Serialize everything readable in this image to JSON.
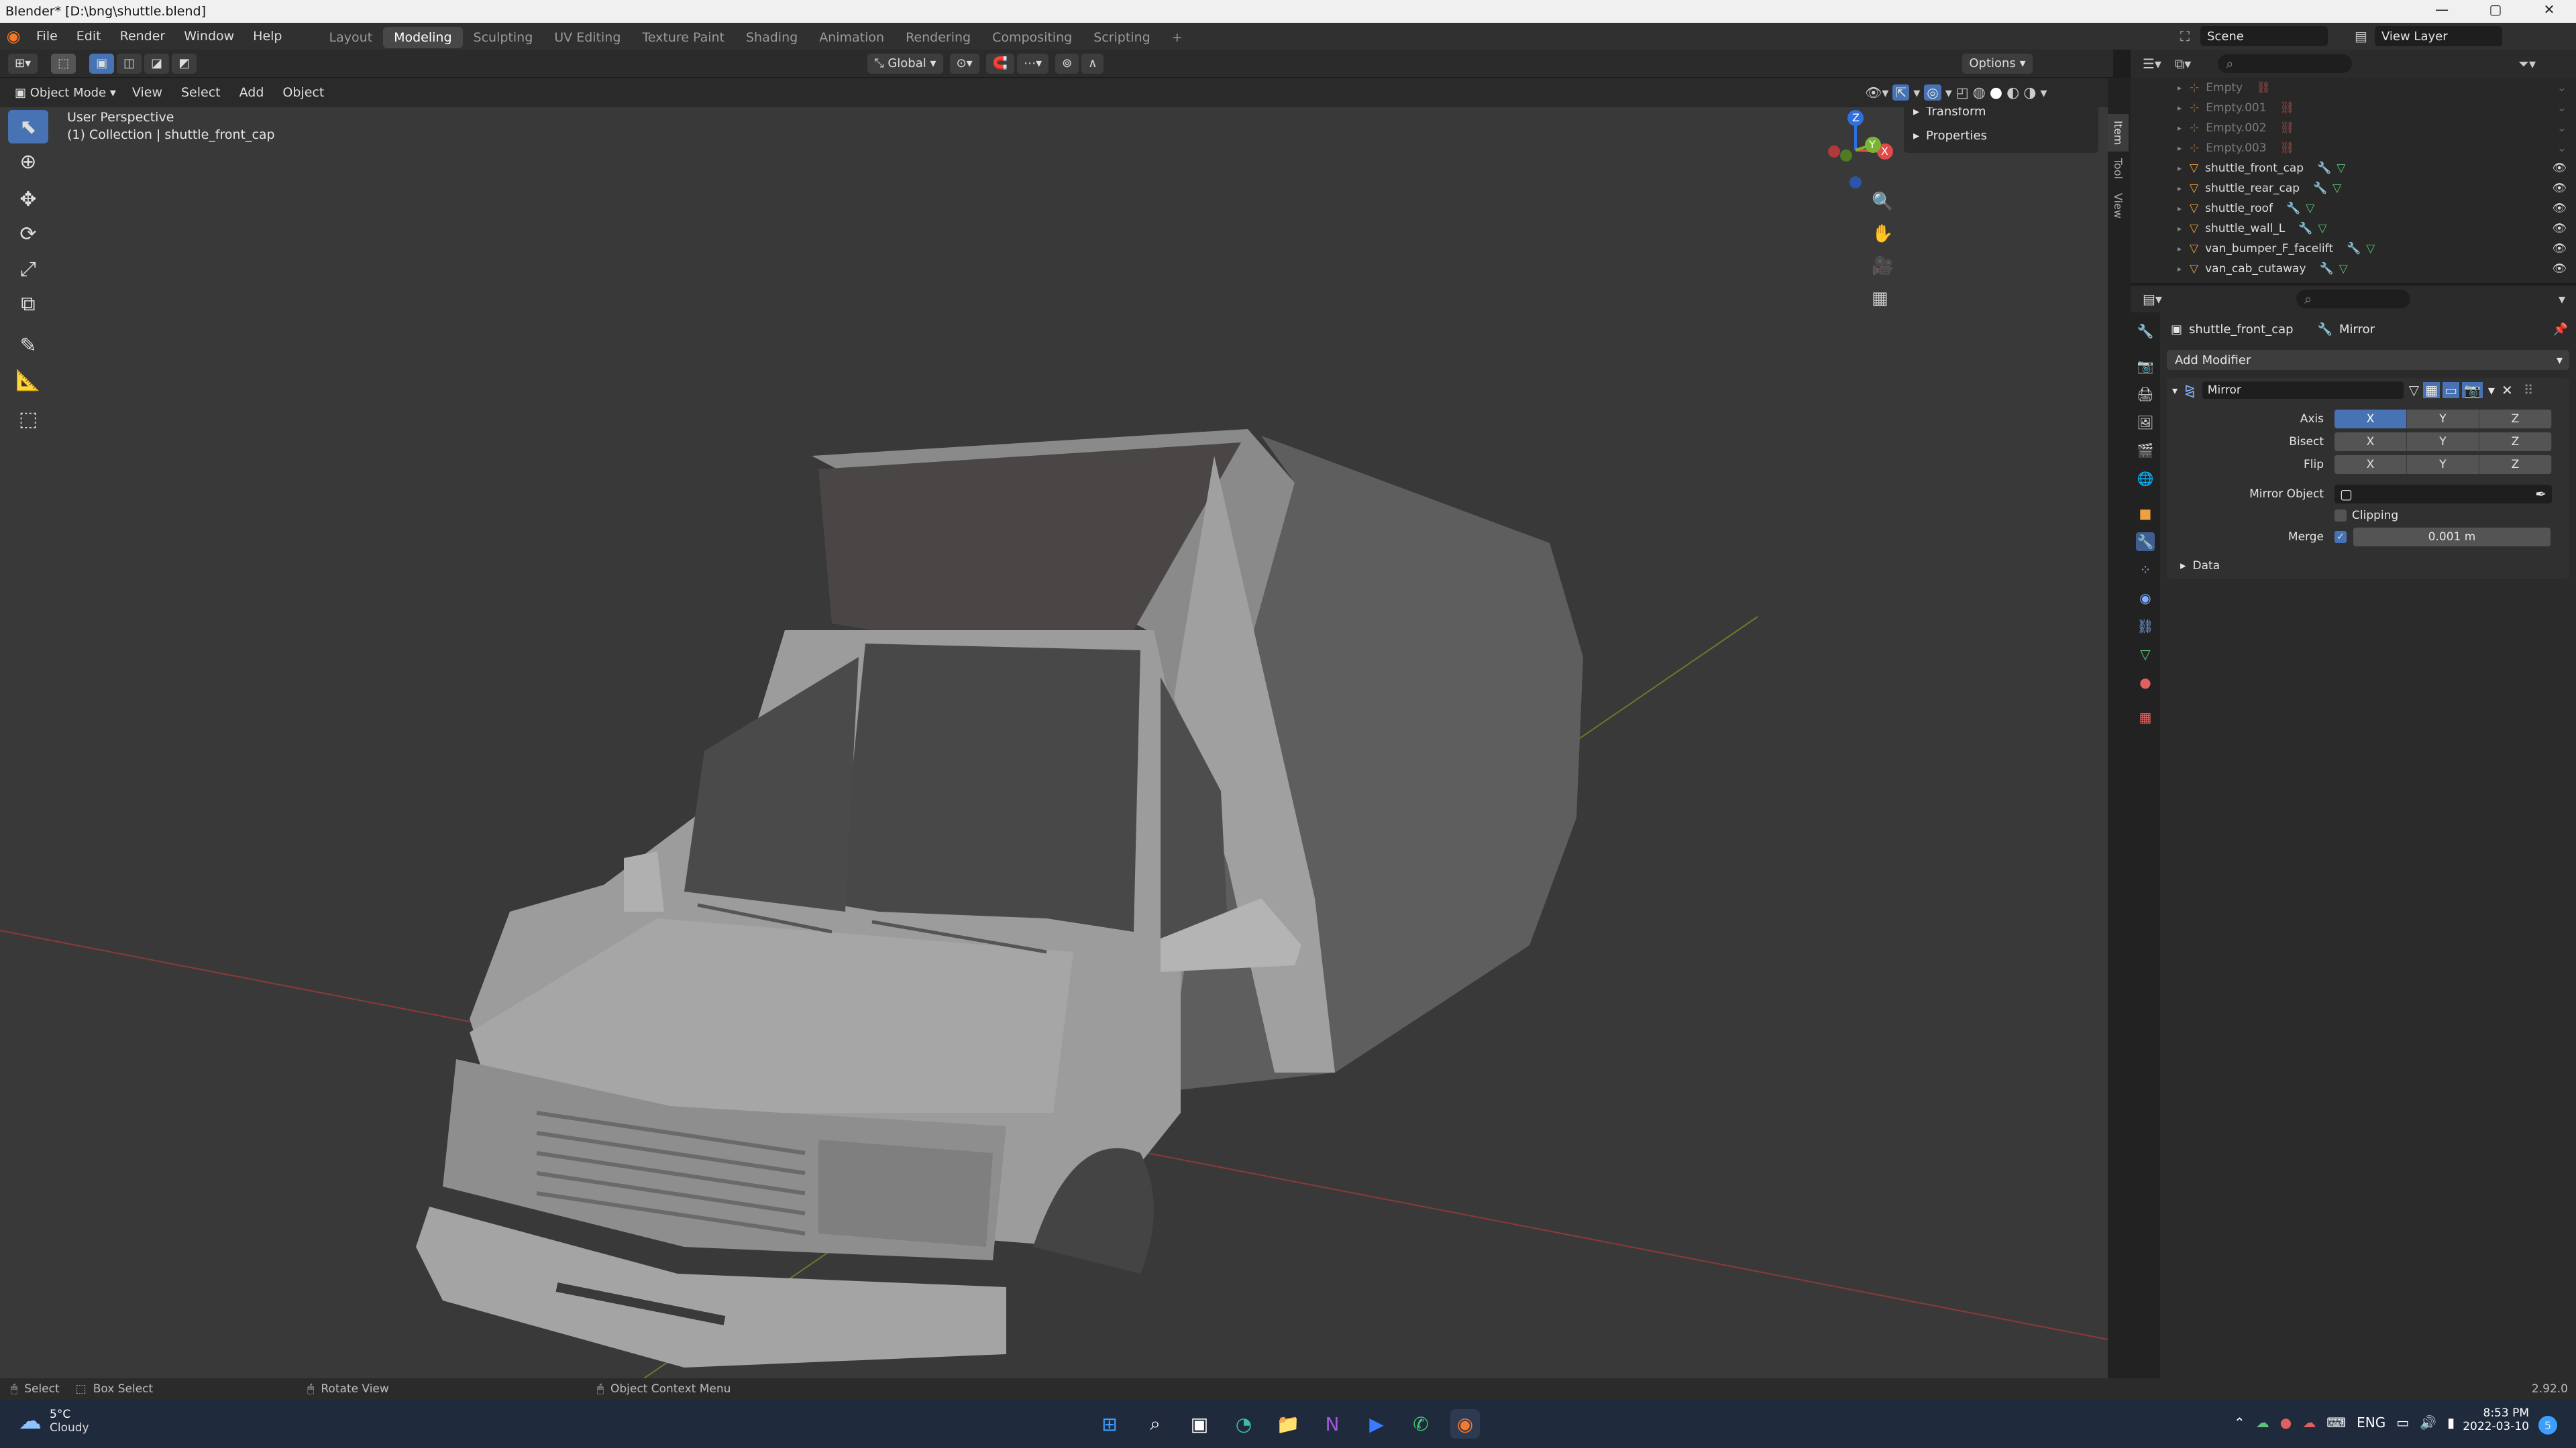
{
  "window": {
    "title": "Blender* [D:\\bng\\shuttle.blend]",
    "minimize": "—",
    "maximize": "▢",
    "close": "✕"
  },
  "menu": [
    "File",
    "Edit",
    "Render",
    "Window",
    "Help"
  ],
  "workspaces": [
    "Layout",
    "Modeling",
    "Sculpting",
    "UV Editing",
    "Texture Paint",
    "Shading",
    "Animation",
    "Rendering",
    "Compositing",
    "Scripting"
  ],
  "active_workspace": "Modeling",
  "scene": {
    "label": "Scene",
    "view_layer": "View Layer"
  },
  "toolrow": {
    "orientation": "Global",
    "options": "Options"
  },
  "viewport_header": {
    "mode": "Object Mode",
    "menus": [
      "View",
      "Select",
      "Add",
      "Object"
    ]
  },
  "viewport": {
    "perspective": "User Perspective",
    "collection": "(1) Collection | shuttle_front_cap",
    "gizmo_x": "X",
    "gizmo_y": "Y",
    "gizmo_z": "Z"
  },
  "npanel": {
    "transform": "Transform",
    "properties": "Properties",
    "tabs": [
      "Item",
      "Tool",
      "View"
    ]
  },
  "outliner": {
    "items": [
      {
        "name": "Empty",
        "dim": true
      },
      {
        "name": "Empty.001",
        "dim": true
      },
      {
        "name": "Empty.002",
        "dim": true
      },
      {
        "name": "Empty.003",
        "dim": true
      },
      {
        "name": "shuttle_front_cap",
        "dim": false
      },
      {
        "name": "shuttle_rear_cap",
        "dim": false
      },
      {
        "name": "shuttle_roof",
        "dim": false
      },
      {
        "name": "shuttle_wall_L",
        "dim": false
      },
      {
        "name": "van_bumper_F_facelift",
        "dim": false
      },
      {
        "name": "van_cab_cutaway",
        "dim": false
      }
    ]
  },
  "properties": {
    "object": "shuttle_front_cap",
    "modifier_breadcrumb": "Mirror",
    "add_modifier": "Add Modifier",
    "modifier_name": "Mirror",
    "axis_label": "Axis",
    "bisect_label": "Bisect",
    "flip_label": "Flip",
    "axes": [
      "X",
      "Y",
      "Z"
    ],
    "mirror_object_label": "Mirror Object",
    "clipping_label": "Clipping",
    "merge_label": "Merge",
    "merge_value": "0.001 m",
    "data_label": "Data"
  },
  "status": {
    "select": "Select",
    "box_select": "Box Select",
    "rotate": "Rotate View",
    "context": "Object Context Menu",
    "version": "2.92.0"
  },
  "taskbar": {
    "temp": "5°C",
    "weather": "Cloudy",
    "lang": "ENG",
    "time": "8:53 PM",
    "date": "2022-03-10"
  }
}
